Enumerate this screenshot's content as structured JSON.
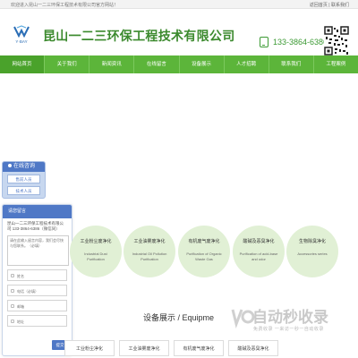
{
  "topbar": {
    "welcome": "欢迎进入昆山一二三环保工程技术有限公司官方网站！",
    "links": "返回首页 | 联系我们"
  },
  "header": {
    "logo_text": "Y·BAY",
    "company_name": "昆山一二三环保工程技术有限公司",
    "phone": "133-3864-6386",
    "phone_icon": "phone-icon",
    "qr_icon": "qr-code"
  },
  "nav": {
    "items": [
      "网站首页",
      "关于我们",
      "新闻资讯",
      "在线留言",
      "设备展示",
      "人才招聘",
      "联系我们",
      "工程案例"
    ]
  },
  "online_service": {
    "title": "在线咨询",
    "buttons": [
      "售前人员",
      "技术人员"
    ]
  },
  "message_panel": {
    "title": "请您留言",
    "company": "昆山一二三环保工程技术有限公司 133-3864-6386（微信同）",
    "textarea_placeholder": "请在此输入留言内容，我们会尽快与您联系。（必填）",
    "fields": [
      {
        "placeholder": "姓名"
      },
      {
        "placeholder": "电话（必填）"
      },
      {
        "placeholder": "邮箱"
      },
      {
        "placeholder": "地址"
      }
    ],
    "submit": "提交"
  },
  "services": [
    {
      "title": "工业粉尘废净化",
      "subtitle": "Industrial Dust Purification"
    },
    {
      "title": "工业油雾废净化",
      "subtitle": "Industrial Oil Pollution Purification"
    },
    {
      "title": "有机废气废净化",
      "subtitle": "Purification of Organic Waste Gas"
    },
    {
      "title": "酸碱及恶臭净化",
      "subtitle": "Purification of acid-base and odor"
    },
    {
      "title": "生物除臭净化",
      "subtitle": "Accessories series"
    }
  ],
  "equipment_section": {
    "title": "设备展示 / Equipme"
  },
  "watermark": {
    "brand": "自动秒收录",
    "slogan": "免费收录 一来访一秒一自动收录"
  },
  "bottom_tabs": [
    "工业粉尘净化",
    "工业油雾废净化",
    "有机废气废净化",
    "酸碱及恶臭净化"
  ],
  "colors": {
    "brand_green": "#5cb53a",
    "title_green": "#3c8a2e",
    "service_blue": "#4f78c6",
    "circle_bg": "#e1f0d5"
  }
}
